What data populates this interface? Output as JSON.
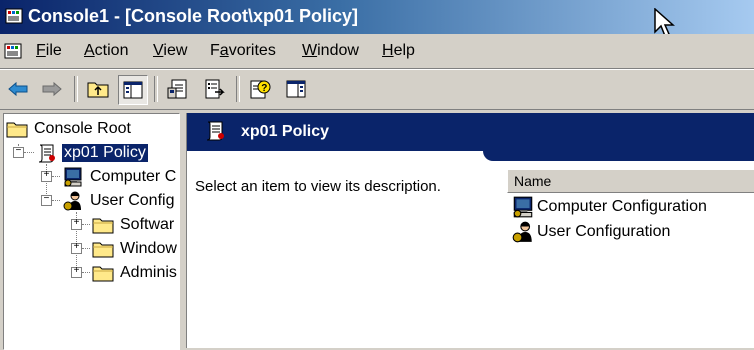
{
  "window": {
    "title": "Console1 - [Console Root\\xp01 Policy]"
  },
  "menubar": {
    "items": [
      {
        "prefix": "",
        "mnemonic": "F",
        "rest": "ile"
      },
      {
        "prefix": "",
        "mnemonic": "A",
        "rest": "ction"
      },
      {
        "prefix": "",
        "mnemonic": "V",
        "rest": "iew"
      },
      {
        "prefix": "F",
        "mnemonic": "a",
        "rest": "vorites"
      },
      {
        "prefix": "",
        "mnemonic": "W",
        "rest": "indow"
      },
      {
        "prefix": "",
        "mnemonic": "H",
        "rest": "elp"
      }
    ]
  },
  "toolbar": {
    "buttons": [
      "back-arrow-icon",
      "forward-arrow-icon",
      "up-folder-icon",
      "show-hide-tree-icon",
      "properties-icon",
      "export-list-icon",
      "help-icon",
      "show-hide-action-pane-icon"
    ]
  },
  "tree": {
    "nodes": [
      {
        "label": "Console Root",
        "icon": "folder-icon"
      },
      {
        "label": "xp01 Policy",
        "icon": "policy-scroll-icon",
        "selected": true
      },
      {
        "label": "Computer C",
        "icon": "computer-configuration-icon"
      },
      {
        "label": "User Config",
        "icon": "user-configuration-icon"
      },
      {
        "label": "Softwar",
        "icon": "folder-icon"
      },
      {
        "label": "Window",
        "icon": "folder-icon"
      },
      {
        "label": "Adminis",
        "icon": "folder-icon"
      }
    ]
  },
  "details": {
    "header_title": "xp01 Policy",
    "description": "Select an item to view its description.",
    "list": {
      "column_name": "Name",
      "items": [
        {
          "label": "Computer Configuration",
          "icon": "computer-configuration-icon"
        },
        {
          "label": "User Configuration",
          "icon": "user-configuration-icon"
        }
      ]
    }
  },
  "colors": {
    "title_bar_start": "#0a246a",
    "title_bar_end": "#a6caf0",
    "selection": "#0a246a",
    "chrome": "#d4d0c8"
  }
}
